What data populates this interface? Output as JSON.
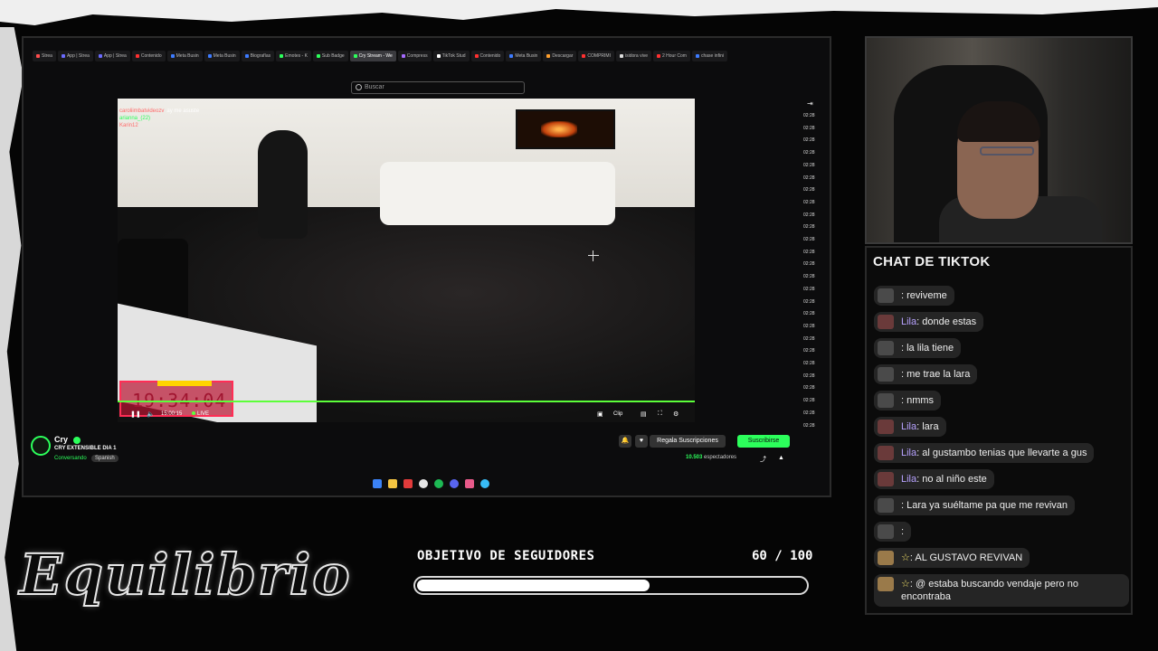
{
  "browser": {
    "tabs": [
      {
        "label": "Strea",
        "color": "#ff4d4d"
      },
      {
        "label": "App | Strea",
        "color": "#6b6bff"
      },
      {
        "label": "App | Strea",
        "color": "#6b6bff"
      },
      {
        "label": "Contenido",
        "color": "#ff3030"
      },
      {
        "label": "Meta Busin",
        "color": "#3d7bff"
      },
      {
        "label": "Meta Busin",
        "color": "#3d7bff"
      },
      {
        "label": "Biografías",
        "color": "#3d7bff"
      },
      {
        "label": "Emotes - K",
        "color": "#2cff5b"
      },
      {
        "label": "Sub Badge",
        "color": "#2cff5b"
      },
      {
        "label": "Cry Stream - We",
        "color": "#2cff5b",
        "active": true
      },
      {
        "label": "Compress",
        "color": "#a66bff"
      },
      {
        "label": "TikTok Stud",
        "color": "#ffffff"
      },
      {
        "label": "Contenido",
        "color": "#ff3030"
      },
      {
        "label": "Meta Busin",
        "color": "#3d7bff"
      },
      {
        "label": "Descargar",
        "color": "#ff9f2c"
      },
      {
        "label": "COMPRIMI",
        "color": "#ff3030"
      },
      {
        "label": "isidora vive",
        "color": "#dddddd"
      },
      {
        "label": "2 Hour Com",
        "color": "#ff3030"
      },
      {
        "label": "chase infini",
        "color": "#3d7bff"
      }
    ],
    "search_placeholder": "Buscar"
  },
  "video": {
    "overlay_chat": [
      {
        "name": "",
        "text": "",
        "color": "#cc88ff"
      },
      {
        "name": "caroliimbatvideozv",
        "text": "ay me asuste",
        "color": "#ff6b6b"
      },
      {
        "name": "arianna_(22)",
        "text": "",
        "color": "#2cff5b"
      },
      {
        "name": "Karin12",
        "text": "",
        "color": "#ff6b6b"
      }
    ],
    "clock": "19:34:04",
    "uptime": "15:00:15",
    "live_label": "LIVE",
    "clip_label": "Clip"
  },
  "side_chat": {
    "times": [
      "02:28",
      "02:28",
      "02:28",
      "02:28",
      "02:28",
      "02:28",
      "02:28",
      "02:28",
      "02:28",
      "02:28",
      "02:28",
      "02:28",
      "02:28",
      "02:28",
      "02:28",
      "02:28",
      "02:28",
      "02:28",
      "02:28",
      "02:28",
      "02:28",
      "02:28",
      "02:28",
      "02:28",
      "02:28",
      "02:28"
    ]
  },
  "channel": {
    "name": "Cry",
    "title": "CRY EXTENSIBLE DIA 1",
    "category": "Conversando",
    "language": "Spanish",
    "gift_label": "Regala Suscripciones",
    "subscribe_label": "Suscribirse",
    "viewers": "10.503",
    "viewers_label": "espectadores"
  },
  "tiktok_chat": {
    "title": "CHAT DE TIKTOK",
    "messages": [
      {
        "name": "",
        "text": ": reviveme",
        "avatar": "#4a4a4a"
      },
      {
        "name": "Lila",
        "text": ": donde estas",
        "avatar": "#6a3a3a"
      },
      {
        "name": "",
        "text": ": la lila tiene",
        "avatar": "#4a4a4a"
      },
      {
        "name": "",
        "text": ": me trae la lara",
        "avatar": "#4a4a4a"
      },
      {
        "name": "",
        "text": ": nmms",
        "avatar": "#4a4a4a"
      },
      {
        "name": "Lila",
        "text": ": lara",
        "avatar": "#6a3a3a"
      },
      {
        "name": "Lila",
        "text": ": al gustambo tenias que llevarte a gus",
        "avatar": "#6a3a3a"
      },
      {
        "name": "Lila",
        "text": ": no al niño este",
        "avatar": "#6a3a3a"
      },
      {
        "name": "",
        "text": ": Lara ya suéltame pa que me revivan",
        "avatar": "#4a4a4a"
      },
      {
        "name": "",
        "text": ":",
        "avatar": "#4a4a4a"
      },
      {
        "name": "☆",
        "text": ": AL GUSTAVO REVIVAN",
        "avatar": "#9a7a4a",
        "star": true
      },
      {
        "name": "☆",
        "text": ": @ estaba buscando vendaje pero no encontraba",
        "avatar": "#9a7a4a",
        "star": true
      }
    ]
  },
  "branding": {
    "logo_text": "Equilibrio"
  },
  "goal": {
    "label": "OBJETIVO DE SEGUIDORES",
    "count": "60 / 100",
    "progress": 0.6
  }
}
